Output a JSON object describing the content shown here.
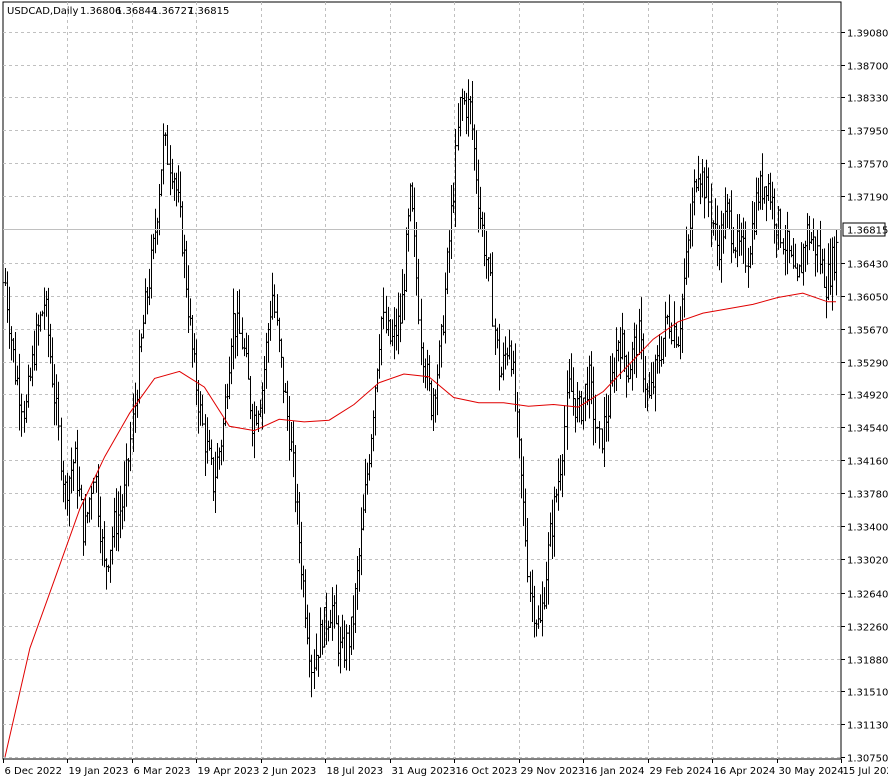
{
  "header": {
    "symbol": "USDCAD,Daily",
    "open": "1.36806",
    "high": "1.36844",
    "low": "1.36727",
    "close": "1.36815"
  },
  "current_price_label": "1.36815",
  "colors": {
    "background": "#ffffff",
    "bars": "#000000",
    "grid": "#c0c0c0",
    "ma_line": "#e00000",
    "price_tag_bg": "#ffffff"
  },
  "chart_data": {
    "type": "ohlc_bar",
    "symbol": "USDCAD",
    "timeframe": "Daily",
    "grid": true,
    "y_ticks": [
      "1.39080",
      "1.38700",
      "1.38330",
      "1.37950",
      "1.37570",
      "1.37190",
      "1.36430",
      "1.36050",
      "1.35670",
      "1.35290",
      "1.34920",
      "1.34540",
      "1.34160",
      "1.33780",
      "1.33400",
      "1.33020",
      "1.32640",
      "1.32260",
      "1.31880",
      "1.31510",
      "1.31130",
      "1.30750"
    ],
    "x_ticks": [
      "6 Dec 2022",
      "19 Jan 2023",
      "6 Mar 2023",
      "19 Apr 2023",
      "2 Jun 2023",
      "18 Jul 2023",
      "31 Aug 2023",
      "16 Oct 2023",
      "29 Nov 2023",
      "16 Jan 2024",
      "29 Feb 2024",
      "16 Apr 2024",
      "30 May 2024",
      "15 Jul 2024"
    ],
    "ylim": [
      1.3075,
      1.3908
    ],
    "last_price": 1.36815,
    "price_path": [
      [
        1.362,
        1.365
      ],
      [
        1.352,
        1.356
      ],
      [
        1.347,
        1.351
      ],
      [
        1.355,
        1.359
      ],
      [
        1.36,
        1.358
      ],
      [
        1.349,
        1.345
      ],
      [
        1.338,
        1.335
      ],
      [
        1.342,
        1.343
      ],
      [
        1.333,
        1.33
      ],
      [
        1.341,
        1.339
      ],
      [
        1.329,
        1.328
      ],
      [
        1.334,
        1.336
      ],
      [
        1.337,
        1.34
      ],
      [
        1.347,
        1.35
      ],
      [
        1.358,
        1.36
      ],
      [
        1.366,
        1.37
      ],
      [
        1.378,
        1.381
      ],
      [
        1.375,
        1.37
      ],
      [
        1.366,
        1.364
      ],
      [
        1.353,
        1.35
      ],
      [
        1.345,
        1.342
      ],
      [
        1.339,
        1.335
      ],
      [
        1.345,
        1.347
      ],
      [
        1.358,
        1.362
      ],
      [
        1.355,
        1.352
      ],
      [
        1.346,
        1.344
      ],
      [
        1.35,
        1.353
      ],
      [
        1.361,
        1.362
      ],
      [
        1.351,
        1.348
      ],
      [
        1.342,
        1.338
      ],
      [
        1.329,
        1.325
      ],
      [
        1.318,
        1.317
      ],
      [
        1.322,
        1.324
      ],
      [
        1.325,
        1.323
      ],
      [
        1.319,
        1.317
      ],
      [
        1.322,
        1.326
      ],
      [
        1.333,
        1.338
      ],
      [
        1.345,
        1.352
      ],
      [
        1.358,
        1.362
      ],
      [
        1.355,
        1.35
      ],
      [
        1.358,
        1.364
      ],
      [
        1.372,
        1.374
      ],
      [
        1.356,
        1.352
      ],
      [
        1.348,
        1.347
      ],
      [
        1.354,
        1.358
      ],
      [
        1.368,
        1.373
      ],
      [
        1.383,
        1.386
      ],
      [
        1.382,
        1.378
      ],
      [
        1.37,
        1.365
      ],
      [
        1.362,
        1.357
      ],
      [
        1.351,
        1.35
      ],
      [
        1.356,
        1.358
      ],
      [
        1.342,
        1.335
      ],
      [
        1.327,
        1.32
      ],
      [
        1.322,
        1.326
      ],
      [
        1.332,
        1.335
      ],
      [
        1.34,
        1.345
      ],
      [
        1.35,
        1.352
      ],
      [
        1.347,
        1.345
      ],
      [
        1.351,
        1.354
      ],
      [
        1.343,
        1.342
      ],
      [
        1.348,
        1.352
      ],
      [
        1.356,
        1.358
      ],
      [
        1.352,
        1.35
      ],
      [
        1.356,
        1.36
      ],
      [
        1.348,
        1.347
      ],
      [
        1.353,
        1.358
      ],
      [
        1.358,
        1.359
      ],
      [
        1.356,
        1.36
      ],
      [
        1.366,
        1.372
      ],
      [
        1.376,
        1.379
      ],
      [
        1.372,
        1.37
      ],
      [
        1.366,
        1.365
      ],
      [
        1.37,
        1.372
      ],
      [
        1.366,
        1.364
      ],
      [
        1.365,
        1.369
      ],
      [
        1.372,
        1.376
      ],
      [
        1.374,
        1.371
      ],
      [
        1.369,
        1.368
      ],
      [
        1.366,
        1.364
      ],
      [
        1.361,
        1.365
      ],
      [
        1.368,
        1.37
      ],
      [
        1.366,
        1.363
      ],
      [
        1.362,
        1.365
      ],
      [
        1.366,
        1.368
      ]
    ],
    "series": [
      {
        "name": "",
        "type": "moving_average",
        "color": "#e00000",
        "x": [
          0,
          0.03,
          0.06,
          0.09,
          0.12,
          0.15,
          0.18,
          0.21,
          0.24,
          0.27,
          0.3,
          0.33,
          0.36,
          0.39,
          0.42,
          0.45,
          0.48,
          0.51,
          0.54,
          0.57,
          0.6,
          0.63,
          0.66,
          0.69,
          0.72,
          0.75,
          0.78,
          0.81,
          0.84,
          0.87,
          0.9,
          0.93,
          0.96,
          0.99,
          1.0
        ],
        "values": [
          1.3075,
          1.32,
          1.328,
          1.336,
          1.342,
          1.347,
          1.351,
          1.3518,
          1.35,
          1.3455,
          1.345,
          1.3463,
          1.346,
          1.3462,
          1.348,
          1.3505,
          1.3515,
          1.3512,
          1.3488,
          1.3482,
          1.3482,
          1.3478,
          1.348,
          1.3477,
          1.3495,
          1.3525,
          1.3555,
          1.3575,
          1.3585,
          1.359,
          1.3595,
          1.3603,
          1.3608,
          1.3598,
          1.3598
        ]
      }
    ]
  }
}
